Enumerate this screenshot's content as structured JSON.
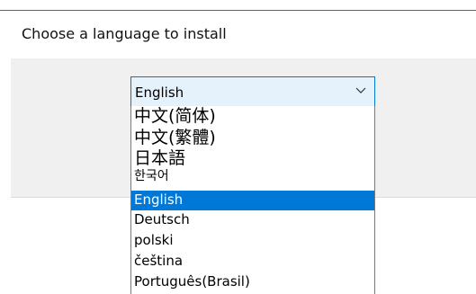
{
  "dialog": {
    "prompt": "Choose a language to install"
  },
  "language_select": {
    "selected_value": "English",
    "chevron_icon": "chevron-down-icon"
  },
  "language_options": [
    "中文(简体)",
    "中文(繁體)",
    "日本語",
    "한국어",
    "English",
    "Deutsch",
    "polski",
    "čeština",
    "Português(Brasil)"
  ],
  "selected_index": 4,
  "colors": {
    "accent": "#0078d7",
    "select_bg": "#e5f1fb",
    "panel_bg": "#f0f0f0"
  }
}
